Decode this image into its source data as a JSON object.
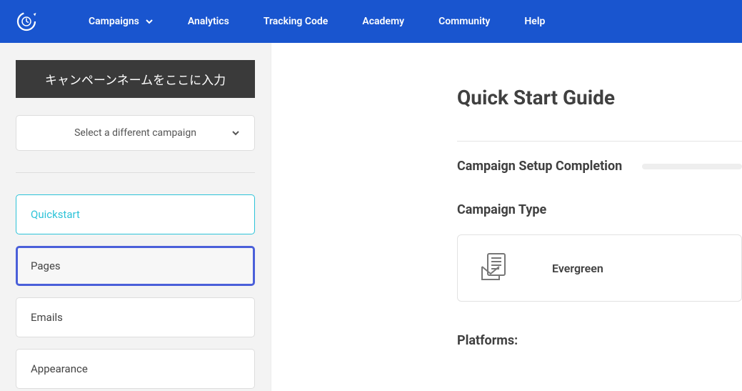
{
  "nav": {
    "items": [
      {
        "label": "Campaigns",
        "has_dropdown": true
      },
      {
        "label": "Analytics",
        "has_dropdown": false
      },
      {
        "label": "Tracking Code",
        "has_dropdown": false
      },
      {
        "label": "Academy",
        "has_dropdown": false
      },
      {
        "label": "Community",
        "has_dropdown": false
      },
      {
        "label": "Help",
        "has_dropdown": false
      }
    ]
  },
  "sidebar": {
    "campaign_name_header": "キャンペーンネームをここに入力",
    "campaign_select_label": "Select a different campaign",
    "items": [
      {
        "label": "Quickstart"
      },
      {
        "label": "Pages"
      },
      {
        "label": "Emails"
      },
      {
        "label": "Appearance"
      }
    ]
  },
  "main": {
    "title": "Quick Start Guide",
    "completion_label": "Campaign Setup Completion",
    "campaign_type_heading": "Campaign Type",
    "campaign_type_value": "Evergreen",
    "platforms_heading": "Platforms:"
  }
}
